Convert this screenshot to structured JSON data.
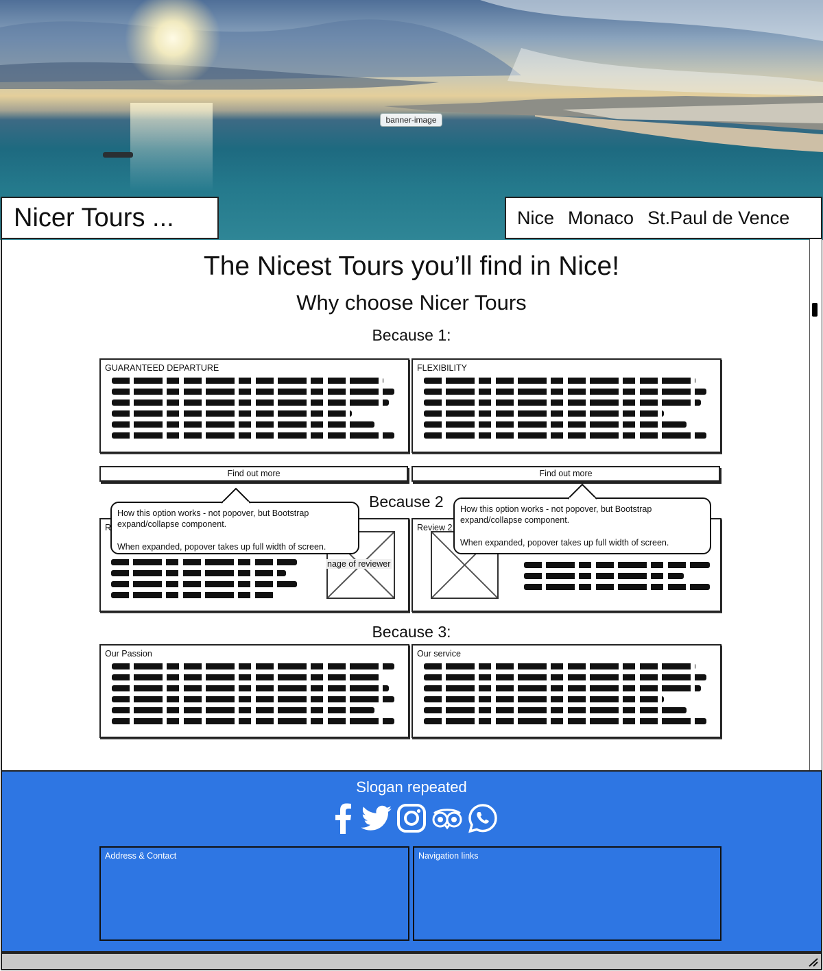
{
  "banner": {
    "tag": "banner-image"
  },
  "header": {
    "brand": "Nicer Tours  ...",
    "nav": [
      "Nice",
      "Monaco",
      "St.Paul de Vence"
    ]
  },
  "main": {
    "title": "The Nicest Tours you’ll find in Nice!",
    "subtitle": "Why choose Nicer Tours",
    "because1": {
      "heading": "Because 1:",
      "cards": [
        {
          "title": "GUARANTEED DEPARTURE",
          "button": "Find out more"
        },
        {
          "title": "FLEXIBILITY",
          "button": "Find out more"
        }
      ]
    },
    "because2": {
      "heading": "Because 2",
      "review1_label": "R",
      "review2_label": "Review 2",
      "image_caption": "nage of reviewer"
    },
    "popover": {
      "line1": "How this option works - not popover, but Bootstrap expand/collapse  component.",
      "line2": "When expanded, popover takes up full width of screen."
    },
    "because3": {
      "heading": "Because 3:",
      "cards": [
        {
          "title": "Our Passion"
        },
        {
          "title": "Our service"
        }
      ]
    }
  },
  "footer": {
    "slogan": "Slogan repeated",
    "social_icons": [
      "facebook-icon",
      "twitter-icon",
      "instagram-icon",
      "tripadvisor-icon",
      "whatsapp-icon"
    ],
    "box_left": "Address & Contact",
    "box_right": "Navigation links",
    "background": "#2e76e3"
  }
}
